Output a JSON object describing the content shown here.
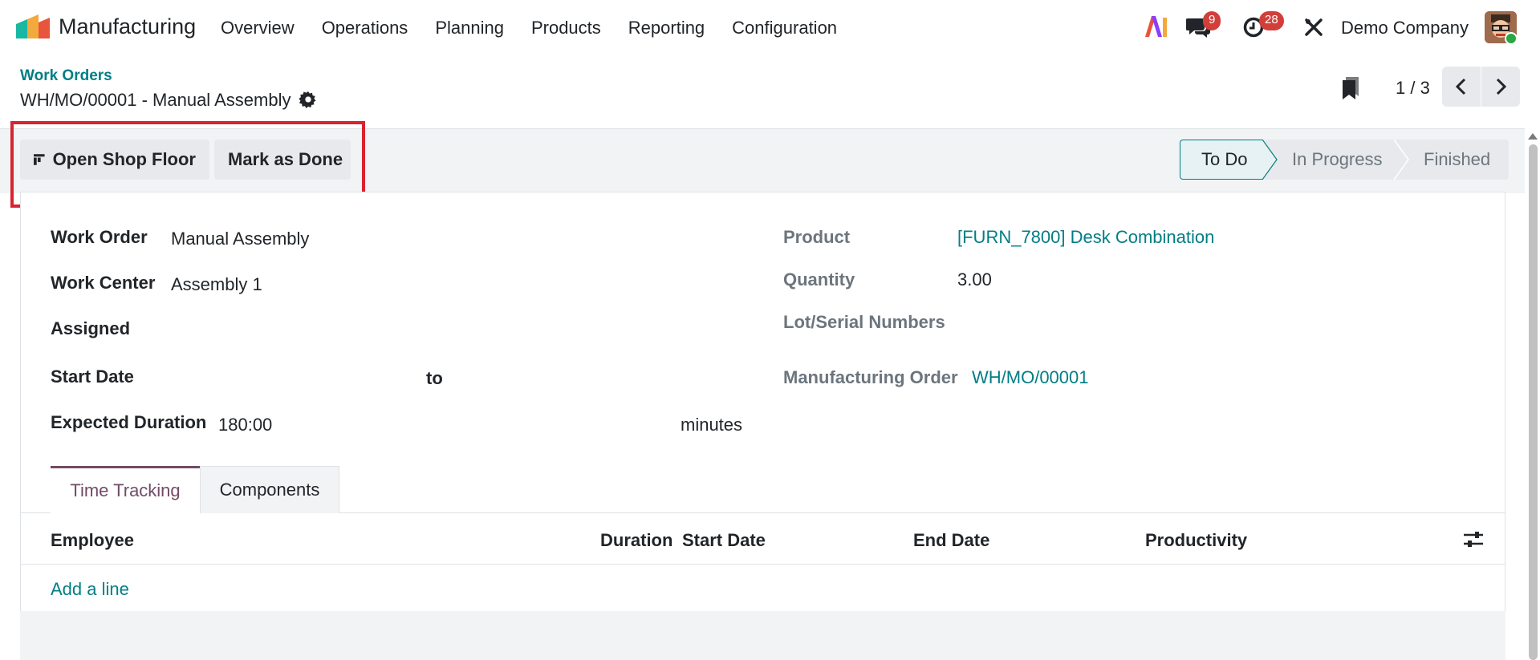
{
  "app": {
    "name": "Manufacturing"
  },
  "menu": [
    "Overview",
    "Operations",
    "Planning",
    "Products",
    "Reporting",
    "Configuration"
  ],
  "systray": {
    "messages_count": "9",
    "activities_count": "28",
    "company": "Demo Company"
  },
  "breadcrumb": "Work Orders",
  "record_title": "WH/MO/00001 - Manual Assembly",
  "pager": {
    "value": "1 / 3"
  },
  "buttons": {
    "open_shop_floor": "Open Shop Floor",
    "mark_done": "Mark as Done"
  },
  "status": {
    "stages": [
      "To Do",
      "In Progress",
      "Finished"
    ],
    "current": "To Do"
  },
  "form": {
    "work_order_label": "Work Order",
    "work_order": "Manual Assembly",
    "work_center_label": "Work Center",
    "work_center": "Assembly 1",
    "assigned_label": "Assigned",
    "start_date_label": "Start Date",
    "date_to": "to",
    "expected_duration_label": "Expected Duration",
    "expected_duration": "180:00",
    "duration_unit": "minutes",
    "product_label": "Product",
    "product": "[FURN_7800] Desk Combination",
    "quantity_label": "Quantity",
    "quantity": "3.00",
    "lots_label": "Lot/Serial Numbers",
    "mo_label": "Manufacturing Order",
    "mo": "WH/MO/00001"
  },
  "tabs": [
    "Time Tracking",
    "Components"
  ],
  "table": {
    "headers": [
      "Employee",
      "Duration",
      "Start Date",
      "End Date",
      "Productivity"
    ],
    "add_line": "Add a line"
  },
  "colors": {
    "accent": "#017e84",
    "brand": "#714b67",
    "highlight": "#d9232e",
    "badge": "#d23f3a"
  }
}
